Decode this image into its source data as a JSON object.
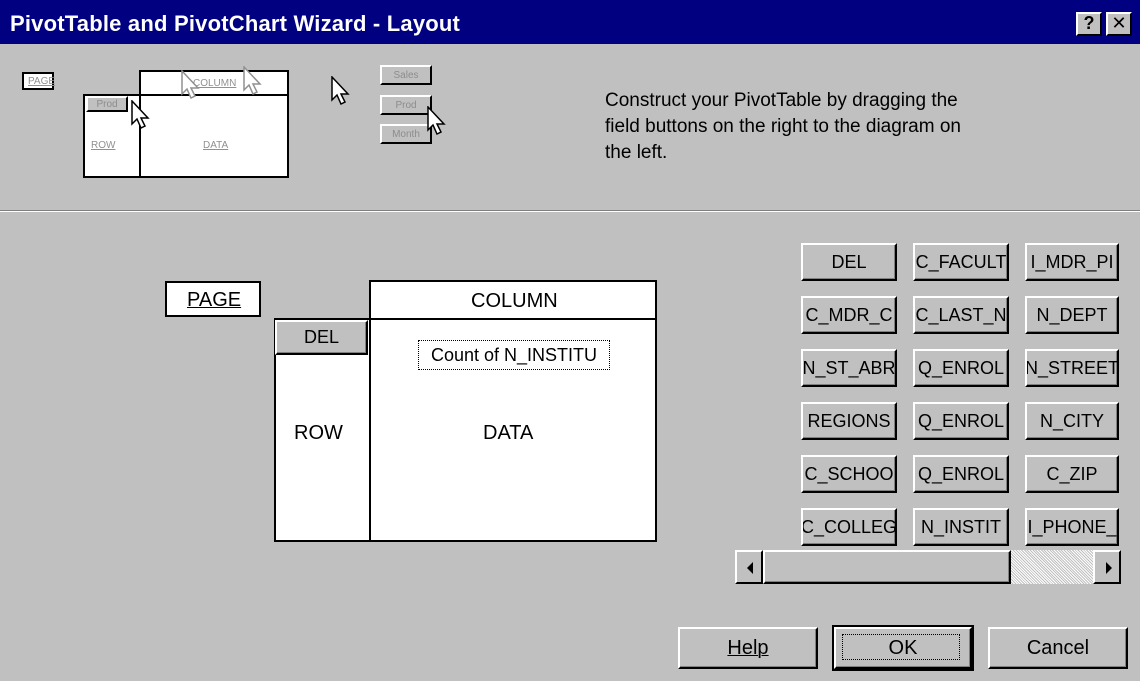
{
  "window": {
    "title": "PivotTable and PivotChart Wizard - Layout",
    "help_glyph": "?",
    "close_glyph": "✕"
  },
  "illustration": {
    "page": "PAGE",
    "column": "COLUMN",
    "row": "ROW",
    "data": "DATA",
    "prod": "Prod",
    "buttons": [
      "Sales",
      "Prod",
      "Month"
    ]
  },
  "instructions": "Construct your PivotTable by dragging the field buttons on the right to the diagram on the left.",
  "diagram": {
    "page_label": "PAGE",
    "column_label": "COLUMN",
    "row_label": "ROW",
    "data_label": "DATA",
    "row_field": "DEL",
    "data_field": "Count of N_INSTITU"
  },
  "fields": [
    [
      "DEL",
      "C_FACULT",
      "I_MDR_PI"
    ],
    [
      "C_MDR_C",
      "C_LAST_N",
      "N_DEPT"
    ],
    [
      "N_ST_ABR",
      "Q_ENROL",
      "N_STREET"
    ],
    [
      "REGIONS",
      "Q_ENROL",
      "N_CITY"
    ],
    [
      "C_SCHOO",
      "Q_ENROL",
      "C_ZIP"
    ],
    [
      "C_COLLEG",
      "N_INSTIT",
      "I_PHONE_"
    ]
  ],
  "buttons": {
    "help": "Help",
    "ok": "OK",
    "cancel": "Cancel"
  }
}
